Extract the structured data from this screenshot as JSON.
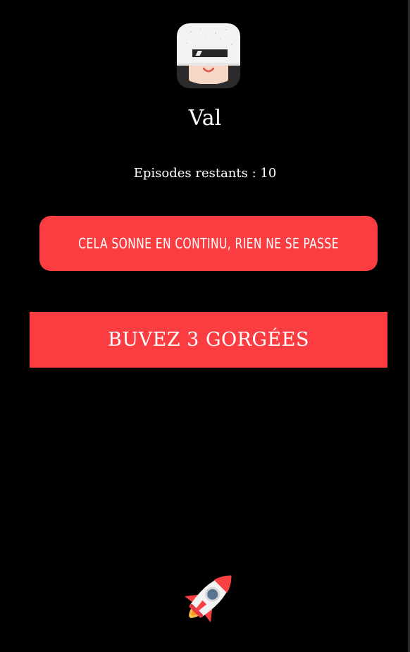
{
  "player": {
    "name": "Val",
    "episodes_label": "Episodes restants : 10",
    "episodes_remaining": 10
  },
  "rule": {
    "text": "CELA SONNE EN CONTINU, RIEN NE SE PASSE"
  },
  "action": {
    "text": "BUVEZ 3 GORGÉES"
  },
  "icons": {
    "avatar": "player-avatar-icon",
    "next": "rocket-icon"
  },
  "colors": {
    "background": "#000000",
    "accent_red": "#fb3d41",
    "text": "#ffffff"
  }
}
